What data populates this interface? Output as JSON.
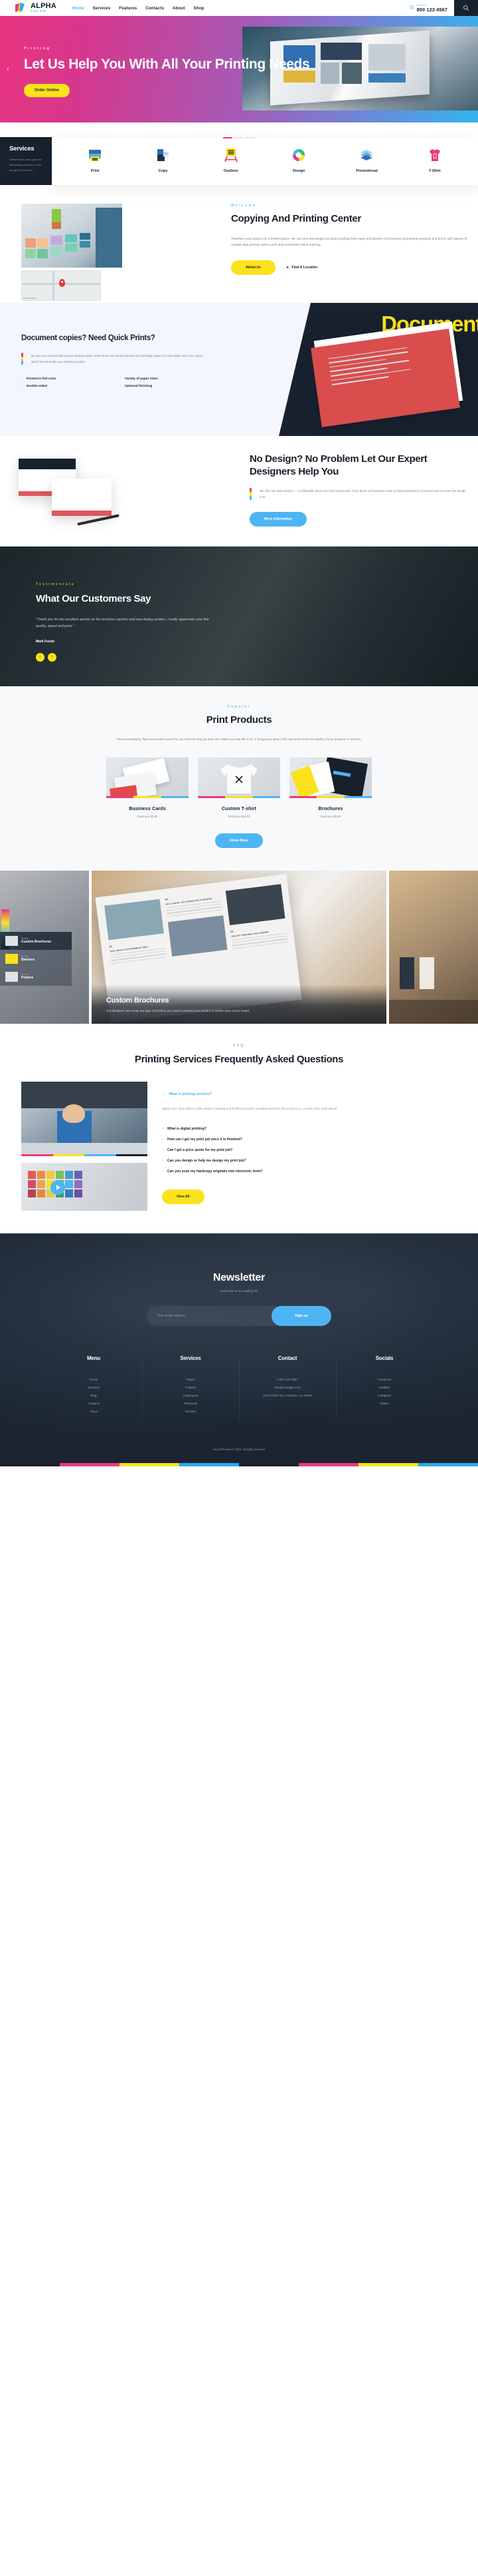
{
  "brand": {
    "name": "ALPHA",
    "sub": "COLOR"
  },
  "nav": {
    "items": [
      {
        "label": "Home",
        "active": true
      },
      {
        "label": "Services",
        "active": false
      },
      {
        "label": "Features",
        "active": false
      },
      {
        "label": "Contacts",
        "active": false
      },
      {
        "label": "About",
        "active": false
      },
      {
        "label": "Shop",
        "active": false
      }
    ]
  },
  "call": {
    "label": "Call us",
    "number": "800 123 4567"
  },
  "hero": {
    "kicker": "Printing",
    "title": "Let Us Help You With All Your Printing Needs",
    "button": "Order Online",
    "prev_arrow": "‹"
  },
  "services": {
    "title": "Services",
    "description": "Online and in store, you can find printing services to help you get the job done",
    "items": [
      {
        "label": "Print",
        "icon": "printer-icon"
      },
      {
        "label": "Copy",
        "icon": "copier-icon"
      },
      {
        "label": "Outdoor",
        "icon": "signboard-icon"
      },
      {
        "label": "Design",
        "icon": "color-wheel-icon"
      },
      {
        "label": "Promotional",
        "icon": "paper-stack-icon"
      },
      {
        "label": "T-Shirt",
        "icon": "tshirt-icon"
      }
    ]
  },
  "welcome": {
    "kicker": "Welcome",
    "title": "Copying And Printing Center",
    "text": "Transform your project into a finished piece. We can print and design just about anything from signs and banners to brochures, promotional products and forms, with options of variable data printing, web-to-print and customized online ordering.",
    "primary_button": "About Us",
    "secondary_link": "Find A Location",
    "map_attrib": "Map data ©2023"
  },
  "doccopy": {
    "title": "Document copies? Need Quick Prints?",
    "text": "We got you covered with all your printing needs. Select from our comprehensive list of printing options for your B&W and color copies which best describe your finished product:",
    "ghost_text": "Document",
    "features": [
      "Printed in full-color",
      "Variety of paper sizes",
      "Double-sided",
      "Optional finishing"
    ]
  },
  "nodesign": {
    "title": "No Design? No Problem Let Our Expert Designers Help You",
    "text": "We offer top class designs — at affordable prices and fast turnarounds. From flyers and business cards to folded pamphlets, brochures and lot more! We design it all.",
    "button": "More Information"
  },
  "testimonials": {
    "kicker": "Testimonials",
    "title": "What Our Customers Say",
    "quote": "\"Thank you for the excellent service on the brochure reprints and new display posters. I really appreciate your fine quality, speed and price.\"",
    "author": "Mark Foster",
    "prev": "‹",
    "next": "›"
  },
  "products": {
    "kicker": "Popular",
    "title": "Print Products",
    "subtitle": "Your presentations, flyers and posters speak for you wherever they go and color makes you look like a pro. It brings your ideas to life and underscores the quality of your products or services.",
    "items": [
      {
        "name": "Business Cards",
        "price": "Starting at $8.99"
      },
      {
        "name": "Custom T-shirt",
        "price": "Starting at $16.00"
      },
      {
        "name": "Brochures",
        "price": "Starting at $8.99"
      }
    ],
    "button": "Show More"
  },
  "gallery": {
    "menu": [
      {
        "kicker": "Printing",
        "label": "Custom Brochures"
      },
      {
        "kicker": "Printing",
        "label": "Banners"
      },
      {
        "kicker": "Printing",
        "label": "Posters"
      }
    ],
    "caption_title": "Custom Brochures",
    "caption_text": "Our designers can create any type of brochure you need to promote your product or tell the story of your brand.",
    "brochure_numbers": [
      "01",
      "02",
      "03"
    ],
    "brochure_titles": [
      "THIS THING IS DISTURBINGLY REAL",
      "NO ALCOHOL, NO COFFEE FOR 19 MONTHS",
      "THE DAY I BECAME A MILLIONAIRE"
    ]
  },
  "faq": {
    "kicker": "FAQ",
    "title": "Printing Services Frequently Asked Questions",
    "open_question": "What is printing services?",
    "open_answer": "Alpha Color Store offers a wide variety of printing and finishing services, including electronic file access (e.g., e-mails, CDs, USB drives)",
    "questions": [
      "What is digital printing?",
      "How can I get my print job once it is finished?",
      "Can I get a price quote for my print job?",
      "Can you design or help me design my print job?",
      "Can you scan my hardcopy originals into electronic form?"
    ],
    "button": "View All"
  },
  "newsletter": {
    "title": "Newsletter",
    "subtitle": "Subscribe to our mailing list",
    "placeholder": "Your email address",
    "value": "",
    "button": "Sign up"
  },
  "footer": {
    "columns": [
      {
        "title": "Menu",
        "items": [
          "Home",
          "Services",
          "Blog",
          "Contacts",
          "About"
        ]
      },
      {
        "title": "Services",
        "items": [
          "Flyers",
          "Posters",
          "Catalogues",
          "Postcards",
          "Stickers"
        ]
      },
      {
        "title": "Contact",
        "items": [
          "1 800 123 4567",
          "info@example.com",
          "1122 Potter Rd, Antelope, CA 32802"
        ]
      },
      {
        "title": "Socials",
        "items": [
          "Facebook",
          "Dribbble",
          "Instagram",
          "Twitter"
        ]
      }
    ],
    "copyright": "AncoraThemes © 2023. All rights reserved."
  },
  "colors": {
    "magenta": "#ec3a7b",
    "yellow": "#fbe21c",
    "cyan": "#4db5f5",
    "dark": "#18222f"
  }
}
